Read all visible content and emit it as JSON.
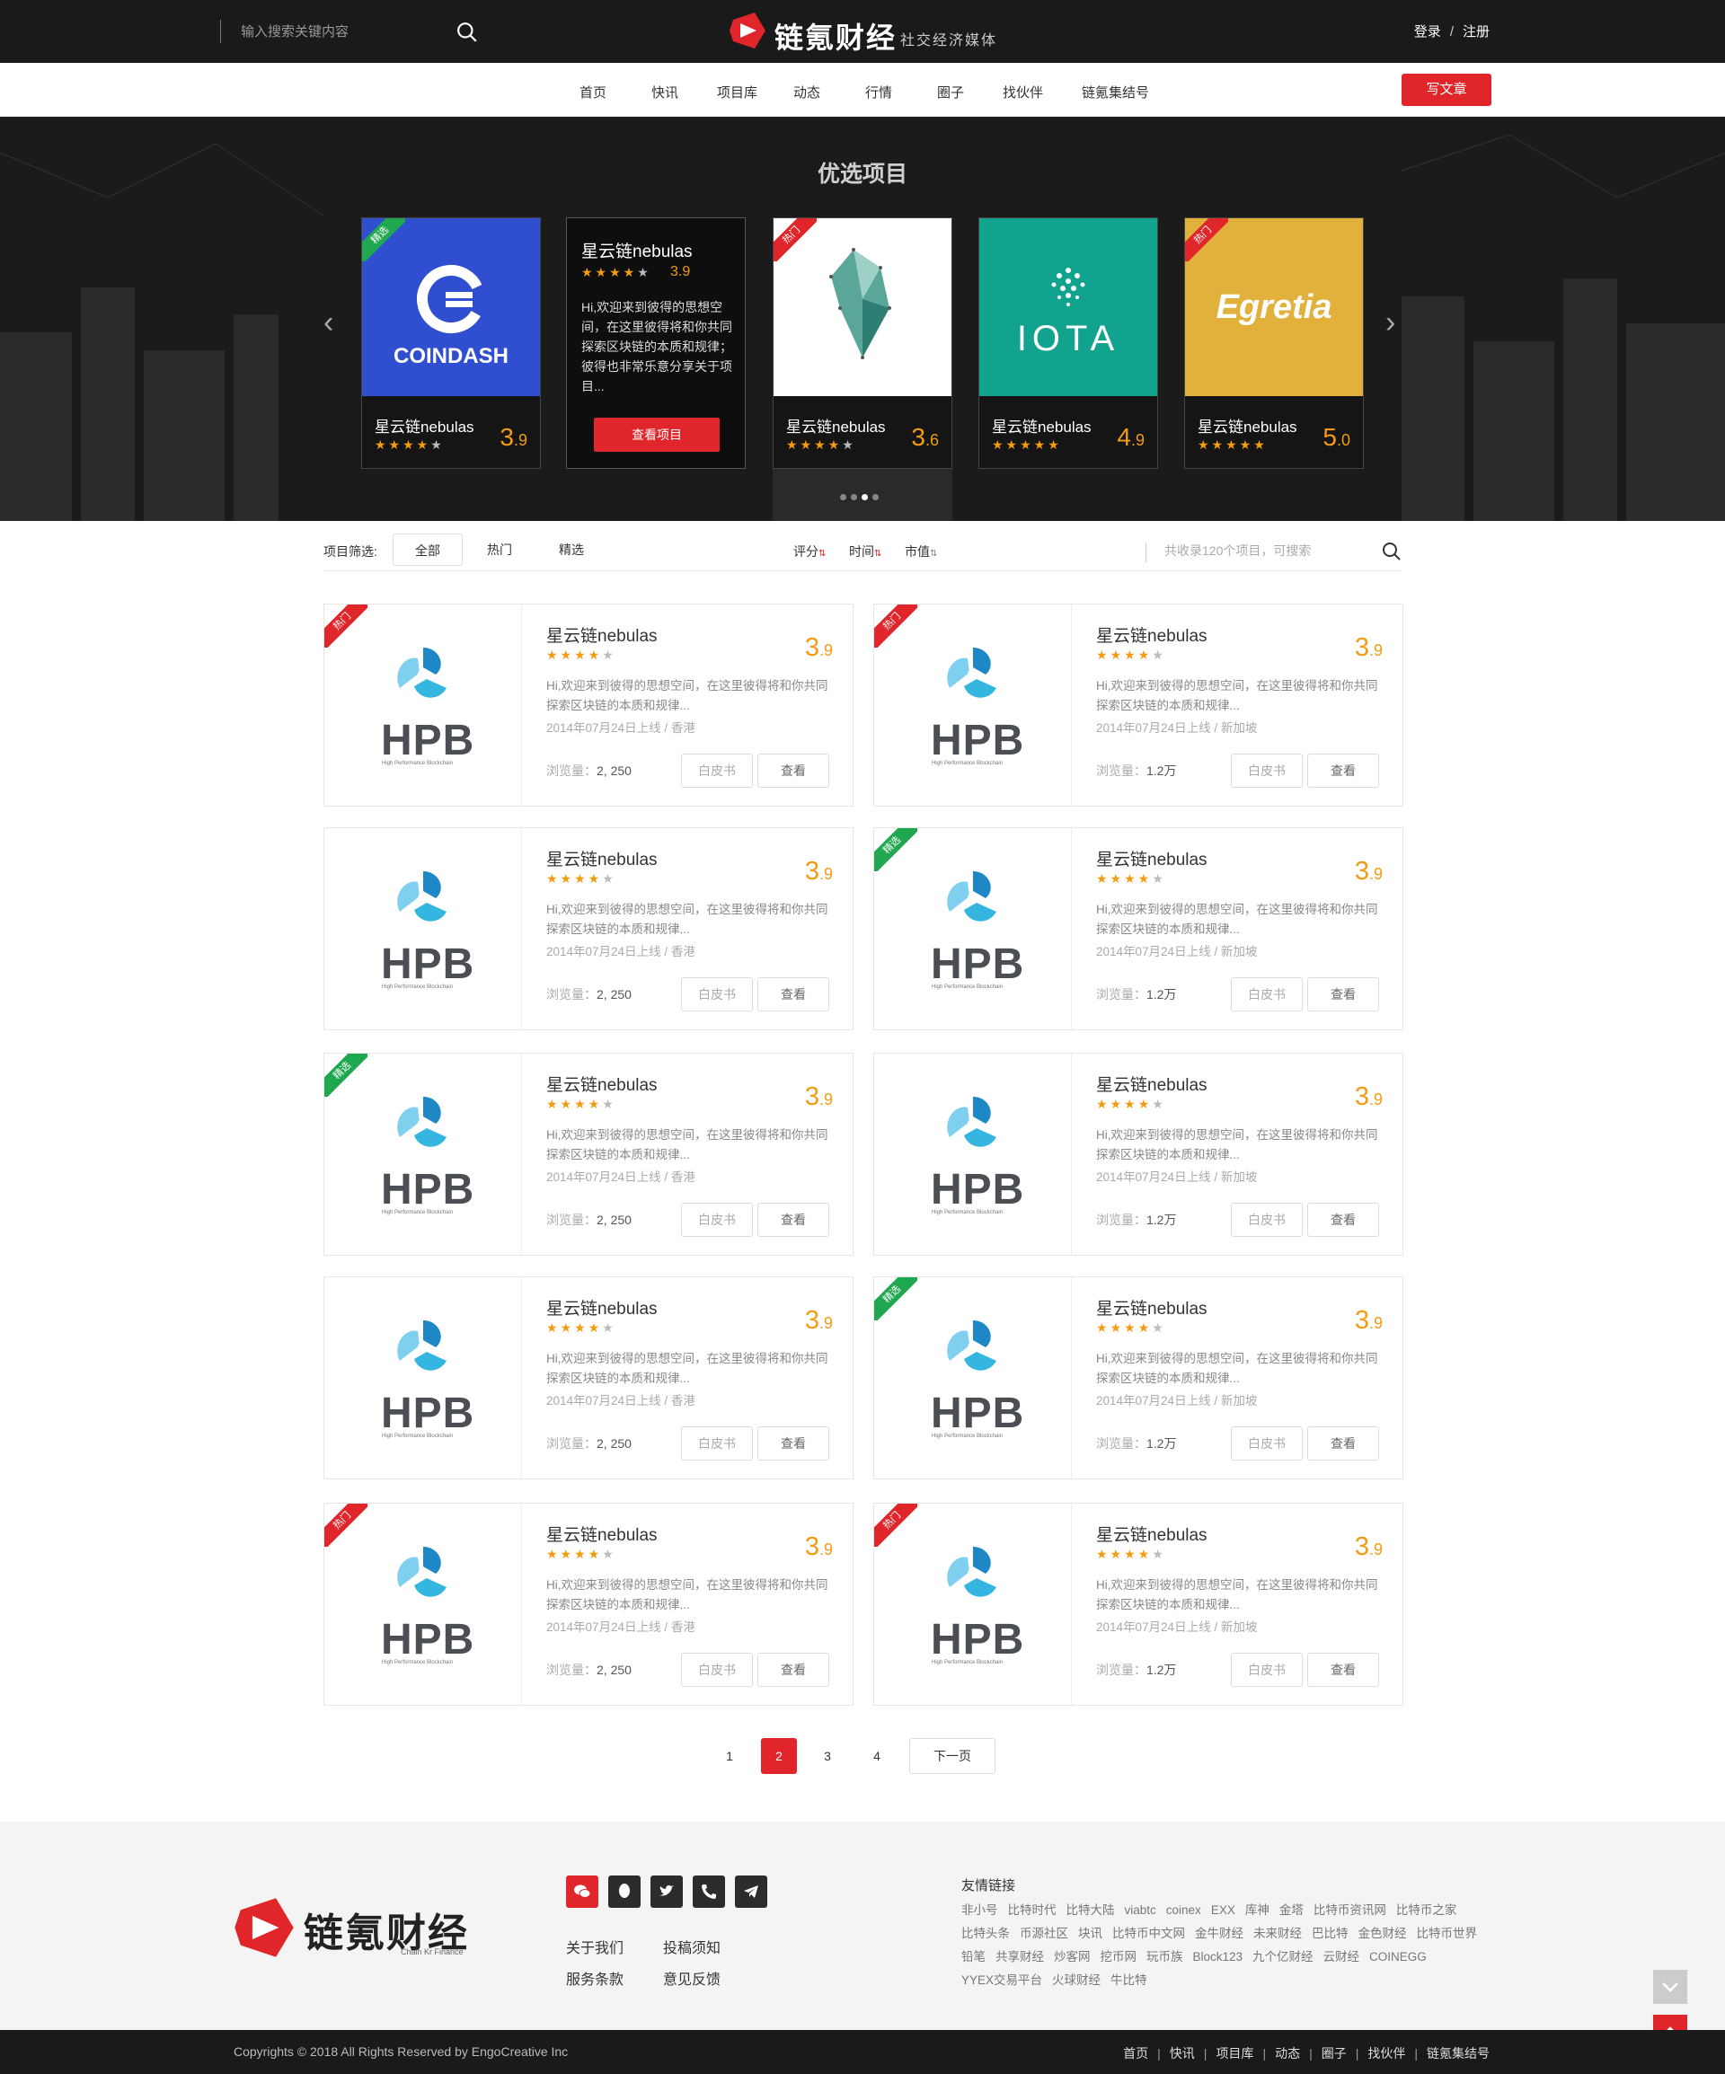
{
  "header": {
    "search_placeholder": "输入搜索关键内容",
    "brand": "链氪财经",
    "slogan": "社交经济媒体",
    "login": "登录",
    "auth_sep": "/",
    "register": "注册"
  },
  "nav": {
    "items": [
      "首页",
      "快讯",
      "项目库",
      "动态",
      "行情",
      "圈子",
      "找伙伴",
      "链氪集结号"
    ],
    "write_button": "写文章"
  },
  "banner": {
    "title": "优选项目",
    "cards": [
      {
        "logo_text": "COINDASH",
        "name": "星云链nebulas",
        "score_int": "3",
        "score_dec": ".9",
        "stars": 4,
        "badge": "精选",
        "badge_color": "#1fa84f",
        "bg": "#2f4fd0"
      },
      {
        "name": "星云链nebulas",
        "score": "3.9",
        "stars": 4,
        "desc": "Hi,欢迎来到彼得的思想空间，在这里彼得将和你共同探索区块链的本质和规律；彼得也非常乐意分享关于项目...",
        "button": "查看项目"
      },
      {
        "logo_text": "",
        "name": "星云链nebulas",
        "score_int": "3",
        "score_dec": ".6",
        "stars": 4,
        "badge": "热门",
        "badge_color": "#e0262a",
        "bg": "#ffffff"
      },
      {
        "logo_text": "IOTA",
        "name": "星云链nebulas",
        "score_int": "4",
        "score_dec": ".9",
        "stars": 5,
        "badge": "",
        "bg": "#12a38e"
      },
      {
        "logo_text": "Egretia",
        "name": "星云链nebulas",
        "score_int": "5",
        "score_dec": ".0",
        "stars": 5,
        "badge": "热门",
        "badge_color": "#e0262a",
        "bg": "#e2b13c"
      }
    ],
    "dots": 4,
    "active_dot": 2
  },
  "filter": {
    "label": "项目筛选:",
    "chips": [
      "全部",
      "热门",
      "精选"
    ],
    "active_chip": 0,
    "sorts": [
      "评分",
      "时间",
      "市值"
    ],
    "search_placeholder": "共收录120个项目，可搜索"
  },
  "projects": [
    {
      "logo": "HPB",
      "logo_sub": "High Performance Blockchain",
      "badge": "热门",
      "badge_color": "#e0262a",
      "name": "星云链nebulas",
      "stars": 4,
      "score_int": "3",
      "score_dec": ".9",
      "desc": "Hi,欢迎来到彼得的思想空间，在这里彼得将和你共同探索区块链的本质和规律...",
      "date": "2014年07月24日上线",
      "meta_sep": "/",
      "location": "香港",
      "views_label": "浏览量：",
      "views": "2, 250",
      "whitepaper": "白皮书",
      "view": "查看"
    },
    {
      "logo": "HPB",
      "logo_sub": "High Performance Blockchain",
      "badge": "热门",
      "badge_color": "#e0262a",
      "name": "星云链nebulas",
      "stars": 4,
      "score_int": "3",
      "score_dec": ".9",
      "desc": "Hi,欢迎来到彼得的思想空间，在这里彼得将和你共同探索区块链的本质和规律...",
      "date": "2014年07月24日上线",
      "meta_sep": "/",
      "location": "新加坡",
      "views_label": "浏览量：",
      "views": "1.2万",
      "whitepaper": "白皮书",
      "view": "查看"
    },
    {
      "logo": "HPB",
      "logo_sub": "High Performance Blockchain",
      "badge": "",
      "name": "星云链nebulas",
      "stars": 4,
      "score_int": "3",
      "score_dec": ".9",
      "desc": "Hi,欢迎来到彼得的思想空间，在这里彼得将和你共同探索区块链的本质和规律...",
      "date": "2014年07月24日上线",
      "meta_sep": "/",
      "location": "香港",
      "views_label": "浏览量：",
      "views": "2, 250",
      "whitepaper": "白皮书",
      "view": "查看"
    },
    {
      "logo": "HPB",
      "logo_sub": "High Performance Blockchain",
      "badge": "精选",
      "badge_color": "#1fa84f",
      "name": "星云链nebulas",
      "stars": 4,
      "score_int": "3",
      "score_dec": ".9",
      "desc": "Hi,欢迎来到彼得的思想空间，在这里彼得将和你共同探索区块链的本质和规律...",
      "date": "2014年07月24日上线",
      "meta_sep": "/",
      "location": "新加坡",
      "views_label": "浏览量：",
      "views": "1.2万",
      "whitepaper": "白皮书",
      "view": "查看"
    },
    {
      "logo": "HPB",
      "logo_sub": "High Performance Blockchain",
      "badge": "精选",
      "badge_color": "#1fa84f",
      "name": "星云链nebulas",
      "stars": 4,
      "score_int": "3",
      "score_dec": ".9",
      "desc": "Hi,欢迎来到彼得的思想空间，在这里彼得将和你共同探索区块链的本质和规律...",
      "date": "2014年07月24日上线",
      "meta_sep": "/",
      "location": "香港",
      "views_label": "浏览量：",
      "views": "2, 250",
      "whitepaper": "白皮书",
      "view": "查看"
    },
    {
      "logo": "HPB",
      "logo_sub": "High Performance Blockchain",
      "badge": "",
      "name": "星云链nebulas",
      "stars": 4,
      "score_int": "3",
      "score_dec": ".9",
      "desc": "Hi,欢迎来到彼得的思想空间，在这里彼得将和你共同探索区块链的本质和规律...",
      "date": "2014年07月24日上线",
      "meta_sep": "/",
      "location": "新加坡",
      "views_label": "浏览量：",
      "views": "1.2万",
      "whitepaper": "白皮书",
      "view": "查看"
    },
    {
      "logo": "HPB",
      "logo_sub": "High Performance Blockchain",
      "badge": "",
      "name": "星云链nebulas",
      "stars": 4,
      "score_int": "3",
      "score_dec": ".9",
      "desc": "Hi,欢迎来到彼得的思想空间，在这里彼得将和你共同探索区块链的本质和规律...",
      "date": "2014年07月24日上线",
      "meta_sep": "/",
      "location": "香港",
      "views_label": "浏览量：",
      "views": "2, 250",
      "whitepaper": "白皮书",
      "view": "查看"
    },
    {
      "logo": "HPB",
      "logo_sub": "High Performance Blockchain",
      "badge": "精选",
      "badge_color": "#1fa84f",
      "name": "星云链nebulas",
      "stars": 4,
      "score_int": "3",
      "score_dec": ".9",
      "desc": "Hi,欢迎来到彼得的思想空间，在这里彼得将和你共同探索区块链的本质和规律...",
      "date": "2014年07月24日上线",
      "meta_sep": "/",
      "location": "新加坡",
      "views_label": "浏览量：",
      "views": "1.2万",
      "whitepaper": "白皮书",
      "view": "查看"
    },
    {
      "logo": "HPB",
      "logo_sub": "High Performance Blockchain",
      "badge": "热门",
      "badge_color": "#e0262a",
      "name": "星云链nebulas",
      "stars": 4,
      "score_int": "3",
      "score_dec": ".9",
      "desc": "Hi,欢迎来到彼得的思想空间，在这里彼得将和你共同探索区块链的本质和规律...",
      "date": "2014年07月24日上线",
      "meta_sep": "/",
      "location": "香港",
      "views_label": "浏览量：",
      "views": "2, 250",
      "whitepaper": "白皮书",
      "view": "查看"
    },
    {
      "logo": "HPB",
      "logo_sub": "High Performance Blockchain",
      "badge": "热门",
      "badge_color": "#e0262a",
      "name": "星云链nebulas",
      "stars": 4,
      "score_int": "3",
      "score_dec": ".9",
      "desc": "Hi,欢迎来到彼得的思想空间，在这里彼得将和你共同探索区块链的本质和规律...",
      "date": "2014年07月24日上线",
      "meta_sep": "/",
      "location": "新加坡",
      "views_label": "浏览量：",
      "views": "1.2万",
      "whitepaper": "白皮书",
      "view": "查看"
    }
  ],
  "pagination": {
    "pages": [
      "1",
      "2",
      "3",
      "4"
    ],
    "active": 1,
    "next": "下一页"
  },
  "footer": {
    "brand": "链氪财经",
    "brand_sub": "Chain Kr Finance",
    "social_icons": [
      "wechat-icon",
      "qq-icon",
      "twitter-icon",
      "phone-icon",
      "telegram-icon"
    ],
    "links": [
      "关于我们",
      "投稿须知",
      "服务条款",
      "意见反馈"
    ],
    "friends_title": "友情链接",
    "friends": [
      "非小号",
      "比特时代",
      "比特大陆",
      "viabtc",
      "coinex",
      "EXX",
      "库神",
      "金塔",
      "比特币资讯网",
      "比特币之家",
      "比特头条",
      "币源社区",
      "块讯",
      "比特币中文网",
      "金牛财经",
      "未来财经",
      "巴比特",
      "金色财经",
      "比特币世界",
      "铅笔",
      "共享财经",
      "炒客网",
      "挖币网",
      "玩币族",
      "Block123",
      "九个亿财经",
      "云财经",
      "COINEGG",
      "YYEX交易平台",
      "火球财经",
      "牛比特"
    ],
    "copyright": "Copyrights © 2018 All Rights Reserved by EngoCreative Inc",
    "bottom_links": [
      "首页",
      "快讯",
      "项目库",
      "动态",
      "圈子",
      "找伙伴",
      "链氪集结号"
    ],
    "bottom_sep": "|"
  },
  "colors": {
    "accent": "#e0262a",
    "score": "#f39c12",
    "green_badge": "#1fa84f",
    "topbar": "#1a1a1a"
  }
}
